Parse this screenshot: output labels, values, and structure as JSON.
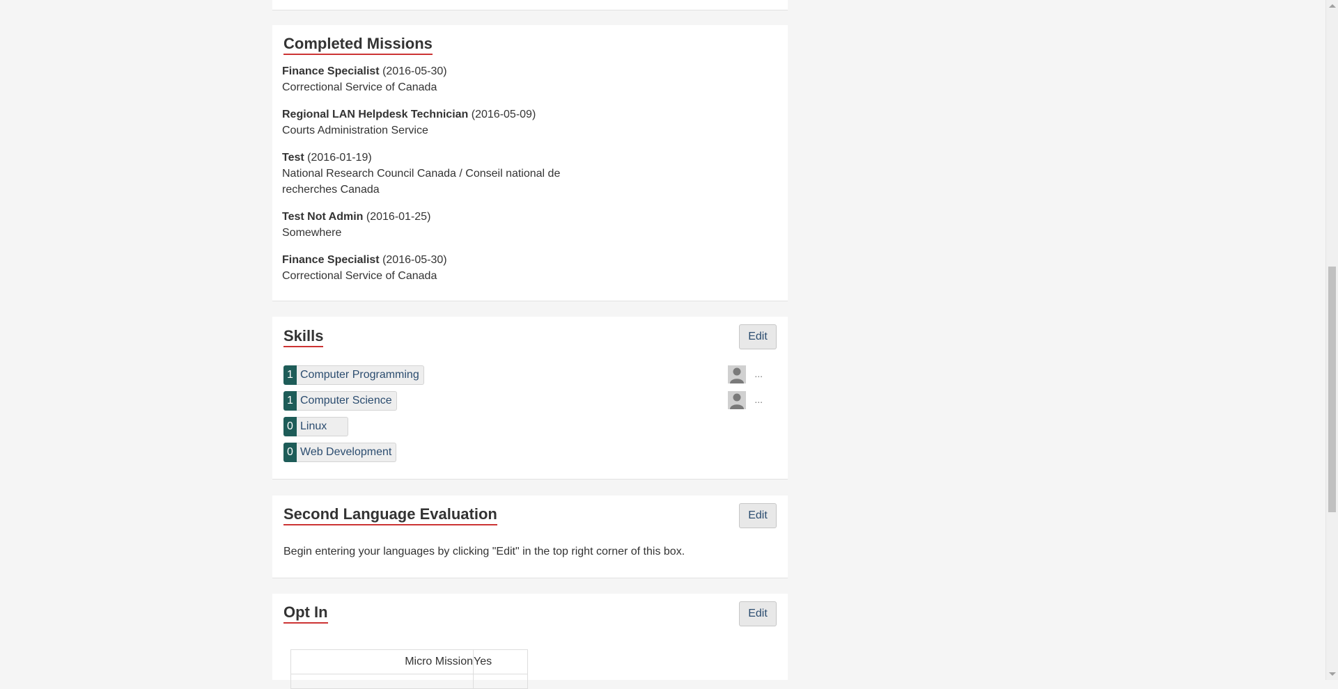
{
  "completed_missions": {
    "title": "Completed Missions",
    "items": [
      {
        "role": "Finance Specialist",
        "date": "(2016-05-30)",
        "org": "Correctional Service of Canada"
      },
      {
        "role": "Regional LAN Helpdesk Technician",
        "date": "(2016-05-09)",
        "org": "Courts Administration Service"
      },
      {
        "role": "Test",
        "date": "(2016-01-19)",
        "org": "National Research Council Canada / Conseil national de recherches Canada"
      },
      {
        "role": "Test Not Admin",
        "date": "(2016-01-25)",
        "org": "Somewhere"
      },
      {
        "role": "Finance Specialist",
        "date": "(2016-05-30)",
        "org": "Correctional Service of Canada"
      }
    ]
  },
  "skills": {
    "title": "Skills",
    "edit_label": "Edit",
    "items": [
      {
        "count": "1",
        "name": "Computer Programming",
        "more": "..."
      },
      {
        "count": "1",
        "name": "Computer Science",
        "more": "..."
      },
      {
        "count": "0",
        "name": "Linux"
      },
      {
        "count": "0",
        "name": "Web Development"
      }
    ]
  },
  "second_language": {
    "title": "Second Language Evaluation",
    "edit_label": "Edit",
    "empty_text": "Begin entering your languages by clicking \"Edit\" in the top right corner of this box."
  },
  "opt_in": {
    "title": "Opt In",
    "edit_label": "Edit",
    "rows": [
      {
        "label": "Micro Mission",
        "value": "Yes"
      }
    ]
  }
}
